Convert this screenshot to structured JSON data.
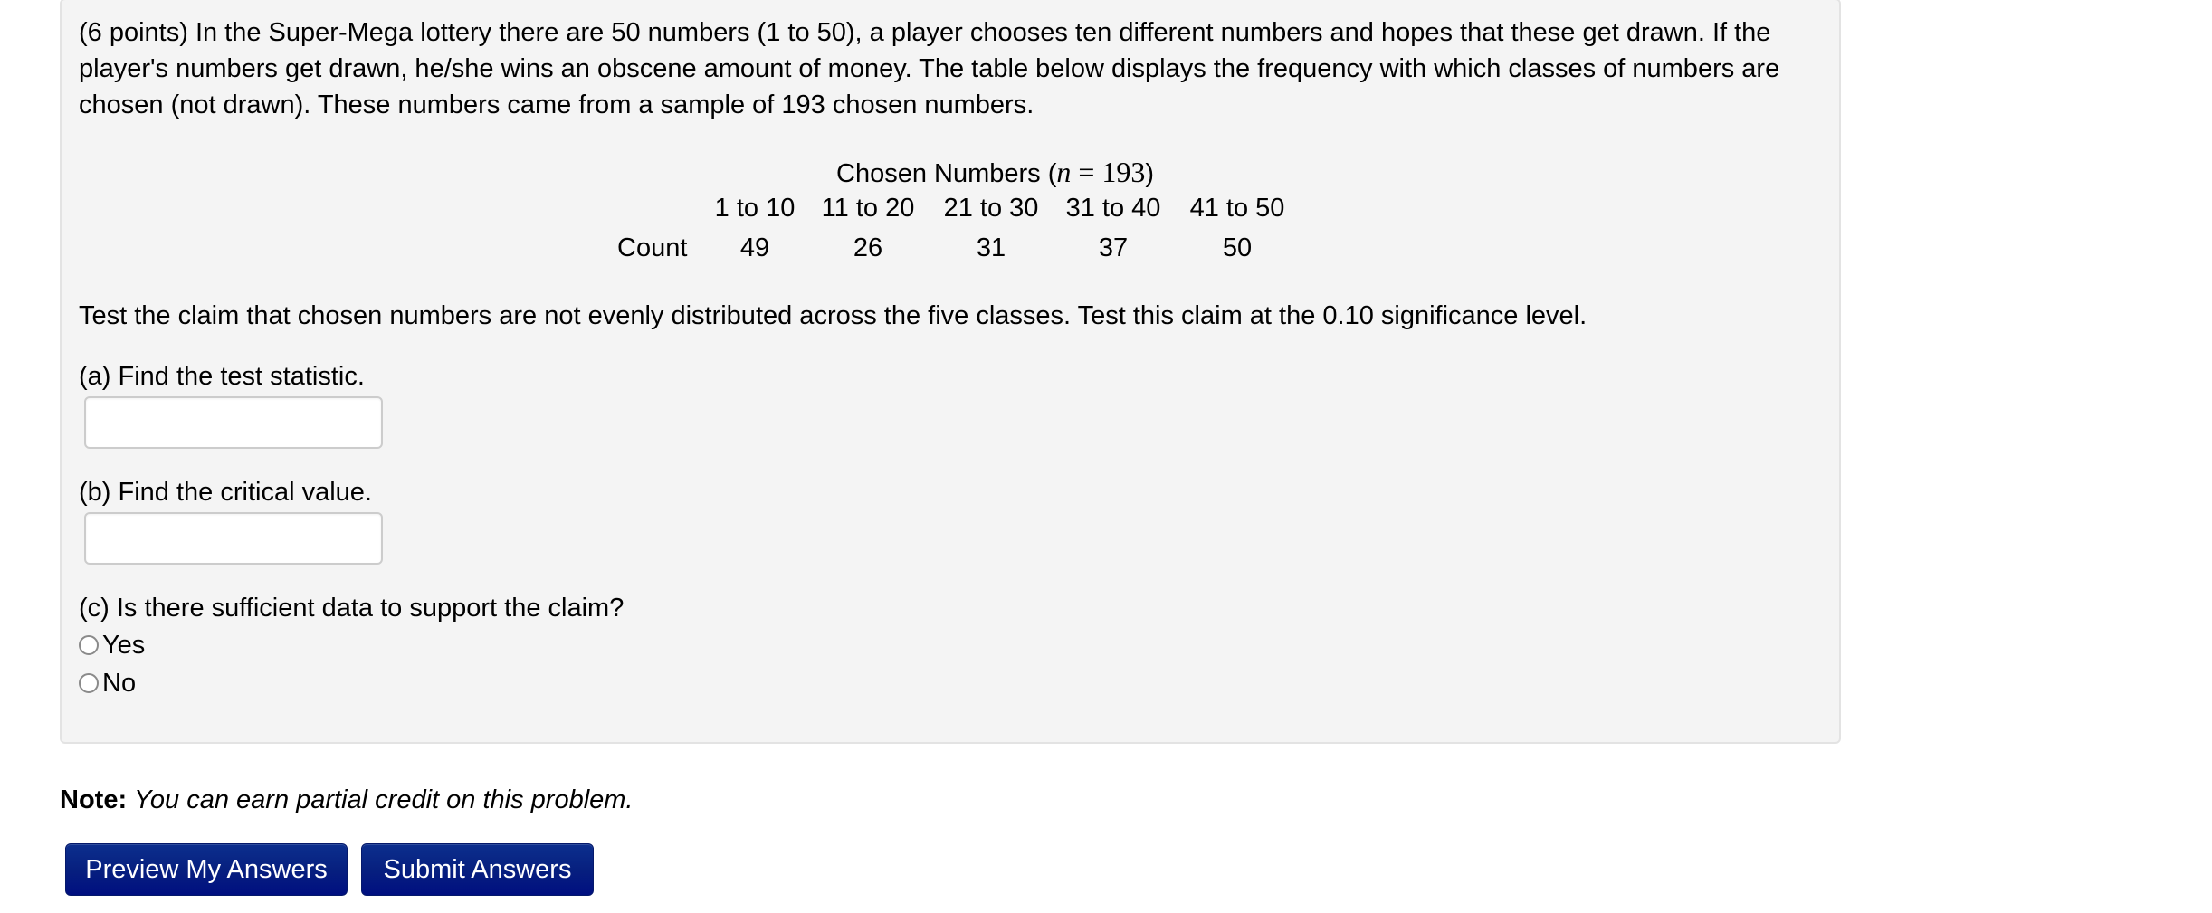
{
  "problem": {
    "intro_text": "(6 points) In the Super-Mega lottery there are 50 numbers (1 to 50), a player chooses ten different numbers and hopes that these get drawn. If the player's numbers get drawn, he/she wins an obscene amount of money. The table below displays the frequency with which classes of numbers are chosen (not drawn). These numbers came from a sample of 193 chosen numbers.",
    "table": {
      "title_prefix": "Chosen Numbers (",
      "title_var": "n",
      "title_eq": " = 193",
      "title_suffix": ")",
      "row_label": "Count",
      "columns": [
        "1 to 10",
        "11 to 20",
        "21 to 30",
        "31 to 40",
        "41 to 50"
      ],
      "counts": [
        "49",
        "26",
        "31",
        "37",
        "50"
      ]
    },
    "claim_text": "Test the claim that chosen numbers are not evenly distributed across the five classes. Test this claim at the 0.10 significance level.",
    "part_a": {
      "label": "(a) Find the test statistic.",
      "value": "",
      "placeholder": ""
    },
    "part_b": {
      "label": "(b) Find the critical value.",
      "value": "",
      "placeholder": ""
    },
    "part_c": {
      "label": "(c) Is there sufficient data to support the claim?",
      "options": [
        {
          "label": "Yes",
          "selected": false
        },
        {
          "label": "No",
          "selected": false
        }
      ]
    }
  },
  "note": {
    "bold": "Note:",
    "italic": "You can earn partial credit on this problem."
  },
  "buttons": {
    "preview": "Preview My Answers",
    "submit": "Submit Answers"
  },
  "colors": {
    "panel_bg": "#f4f4f4",
    "button_bg": "#07207f",
    "button_text": "#ffffff"
  }
}
